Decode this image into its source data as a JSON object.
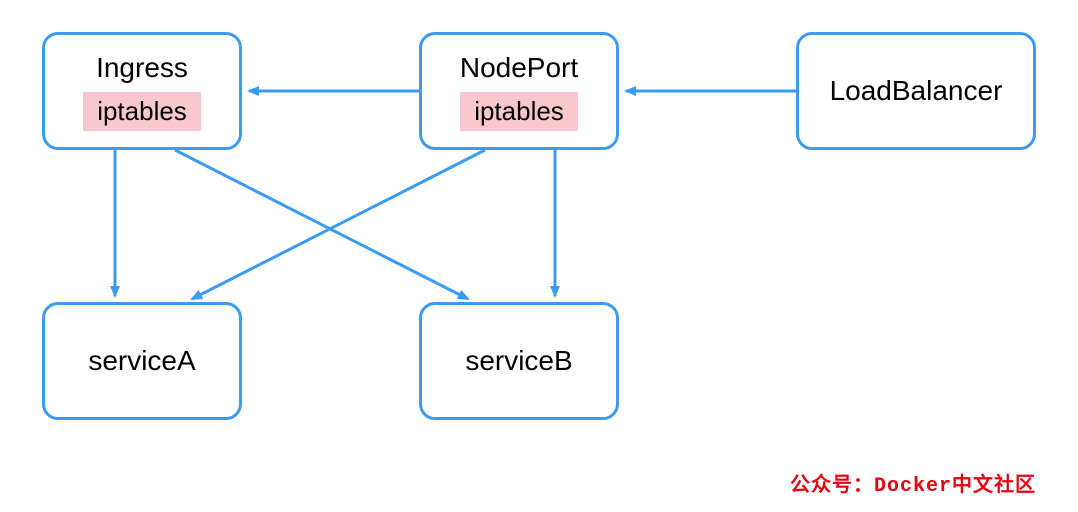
{
  "nodes": {
    "ingress": {
      "title": "Ingress",
      "tag": "iptables"
    },
    "nodeport": {
      "title": "NodePort",
      "tag": "iptables"
    },
    "loadbalancer": {
      "title": "LoadBalancer"
    },
    "serviceA": {
      "title": "serviceA"
    },
    "serviceB": {
      "title": "serviceB"
    }
  },
  "colors": {
    "border": "#3b9bf4",
    "arrow": "#3b9bf4",
    "tagBg": "#f8c8ce",
    "watermark": "#e60012"
  },
  "watermark": "公众号：Docker中文社区"
}
